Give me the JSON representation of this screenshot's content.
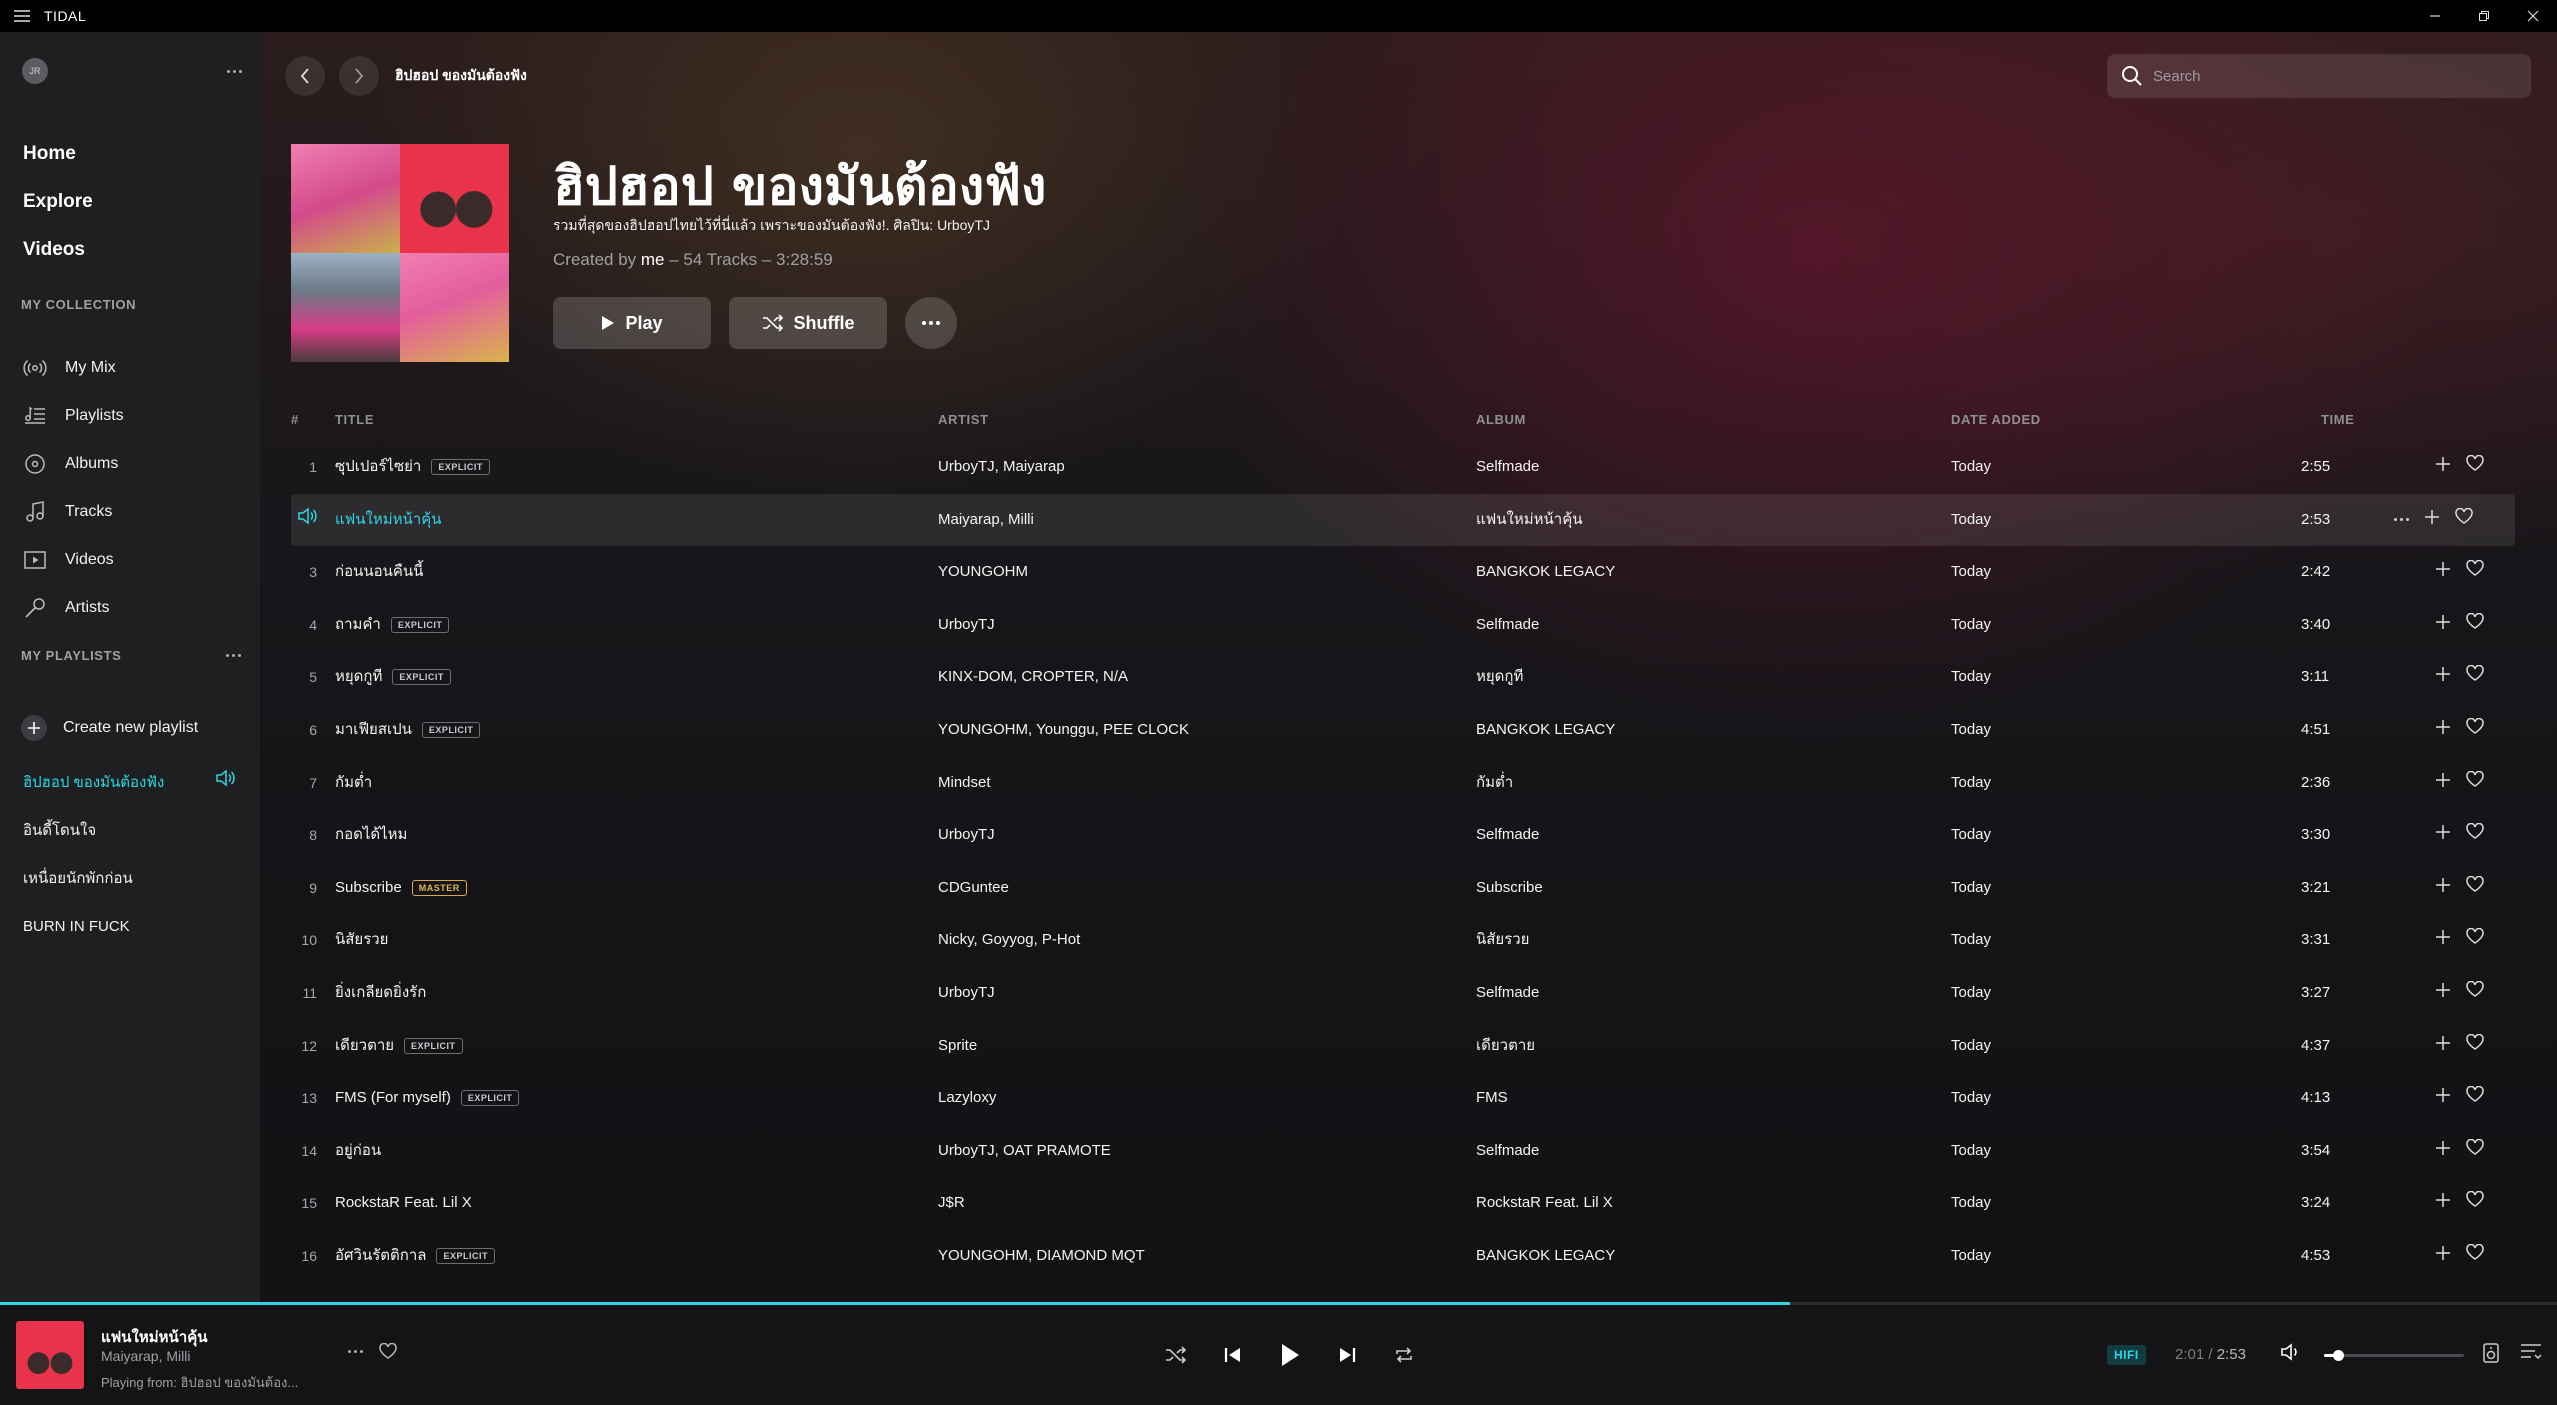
{
  "window": {
    "title": "TIDAL"
  },
  "sidebar": {
    "avatar_initials": "JR",
    "nav": [
      {
        "label": "Home",
        "name": "nav-home"
      },
      {
        "label": "Explore",
        "name": "nav-explore"
      },
      {
        "label": "Videos",
        "name": "nav-videos"
      }
    ],
    "collection_heading": "MY COLLECTION",
    "collection": [
      {
        "label": "My Mix",
        "icon": "radio-icon"
      },
      {
        "label": "Playlists",
        "icon": "playlist-icon"
      },
      {
        "label": "Albums",
        "icon": "disc-icon"
      },
      {
        "label": "Tracks",
        "icon": "note-icon"
      },
      {
        "label": "Videos",
        "icon": "video-icon"
      },
      {
        "label": "Artists",
        "icon": "mic-icon"
      }
    ],
    "playlists_heading": "MY PLAYLISTS",
    "create_label": "Create new playlist",
    "playlists": [
      {
        "label": "ฮิปฮอป ของมันต้องฟัง",
        "active": true
      },
      {
        "label": "อินดี้โดนใจ",
        "active": false
      },
      {
        "label": "เหนื่อยนักพักก่อน",
        "active": false
      },
      {
        "label": "BURN IN FUCK",
        "active": false
      }
    ]
  },
  "header": {
    "breadcrumb_title": "ฮิปฮอป ของมันต้องฟัง",
    "search_placeholder": "Search"
  },
  "playlist": {
    "title": "ฮิปฮอป ของมันต้องฟัง",
    "description": "รวมที่สุดของฮิปฮอปไทยไว้ที่นี่แล้ว เพราะของมันต้องฟัง!. ศิลปิน: UrboyTJ",
    "created_prefix": "Created by ",
    "creator": "me",
    "created_suffix": " – 54 Tracks – 3:28:59",
    "play_label": "Play",
    "shuffle_label": "Shuffle"
  },
  "table": {
    "headers": {
      "num": "#",
      "title": "TITLE",
      "artist": "ARTIST",
      "album": "ALBUM",
      "date": "DATE ADDED",
      "time": "TIME"
    },
    "rows": [
      {
        "num": "1",
        "title": "ซุปเปอร์ไซย่า",
        "badge": "EXPLICIT",
        "artist": "UrboyTJ, Maiyarap",
        "album": "Selfmade",
        "date": "Today",
        "time": "2:55"
      },
      {
        "num": "",
        "title": "แฟนใหม่หน้าคุ้น",
        "badge": "",
        "artist": "Maiyarap, Milli",
        "album": "แฟนใหม่หน้าคุ้น",
        "date": "Today",
        "time": "2:53",
        "playing": true
      },
      {
        "num": "3",
        "title": "ก่อนนอนคืนนี้",
        "badge": "",
        "artist": "YOUNGOHM",
        "album": "BANGKOK LEGACY",
        "date": "Today",
        "time": "2:42"
      },
      {
        "num": "4",
        "title": "ถามคำ",
        "badge": "EXPLICIT",
        "artist": "UrboyTJ",
        "album": "Selfmade",
        "date": "Today",
        "time": "3:40"
      },
      {
        "num": "5",
        "title": "หยุดกูที",
        "badge": "EXPLICIT",
        "artist": "KINX-DOM, CROPTER, N/A",
        "album": "หยุดกูที",
        "date": "Today",
        "time": "3:11"
      },
      {
        "num": "6",
        "title": "มาเฟียสเปน",
        "badge": "EXPLICIT",
        "artist": "YOUNGOHM, Younggu, PEE CLOCK",
        "album": "BANGKOK LEGACY",
        "date": "Today",
        "time": "4:51"
      },
      {
        "num": "7",
        "title": "กัมต่ำ",
        "badge": "",
        "artist": "Mindset",
        "album": "กัมต่ำ",
        "date": "Today",
        "time": "2:36"
      },
      {
        "num": "8",
        "title": "กอดได้ไหม",
        "badge": "",
        "artist": "UrboyTJ",
        "album": "Selfmade",
        "date": "Today",
        "time": "3:30"
      },
      {
        "num": "9",
        "title": "Subscribe",
        "badge": "MASTER",
        "artist": "CDGuntee",
        "album": "Subscribe",
        "date": "Today",
        "time": "3:21"
      },
      {
        "num": "10",
        "title": "นิสัยรวย",
        "badge": "",
        "artist": "Nicky, Goyyog, P-Hot",
        "album": "นิสัยรวย",
        "date": "Today",
        "time": "3:31"
      },
      {
        "num": "11",
        "title": "ยิ่งเกลียดยิ่งรัก",
        "badge": "",
        "artist": "UrboyTJ",
        "album": "Selfmade",
        "date": "Today",
        "time": "3:27"
      },
      {
        "num": "12",
        "title": "เดียวตาย",
        "badge": "EXPLICIT",
        "artist": "Sprite",
        "album": "เดียวตาย",
        "date": "Today",
        "time": "4:37"
      },
      {
        "num": "13",
        "title": "FMS (For myself)",
        "badge": "EXPLICIT",
        "artist": "Lazyloxy",
        "album": "FMS",
        "date": "Today",
        "time": "4:13"
      },
      {
        "num": "14",
        "title": "อยู่ก่อน",
        "badge": "",
        "artist": "UrboyTJ, OAT PRAMOTE",
        "album": "Selfmade",
        "date": "Today",
        "time": "3:54"
      },
      {
        "num": "15",
        "title": "RockstaR Feat. Lil X",
        "badge": "",
        "artist": "J$R",
        "album": "RockstaR Feat. Lil X",
        "date": "Today",
        "time": "3:24"
      },
      {
        "num": "16",
        "title": "อัศวินรัตติกาล",
        "badge": "EXPLICIT",
        "artist": "YOUNGOHM, DIAMOND MQT",
        "album": "BANGKOK LEGACY",
        "date": "Today",
        "time": "4:53"
      }
    ]
  },
  "player": {
    "title": "แฟนใหม่หน้าคุ้น",
    "artist": "Maiyarap, Milli",
    "from_label": "Playing from:",
    "from_value": "ฮิปฮอป ของมันต้อง...",
    "quality": "HIFI",
    "elapsed": "2:01",
    "separator": " / ",
    "total": "2:53",
    "progress_fraction": 0.7,
    "volume_fraction": 0.1
  },
  "colors": {
    "accent": "#2ed6e3",
    "sidebar_bg": "#1e1f21",
    "player_bg": "#141416"
  }
}
